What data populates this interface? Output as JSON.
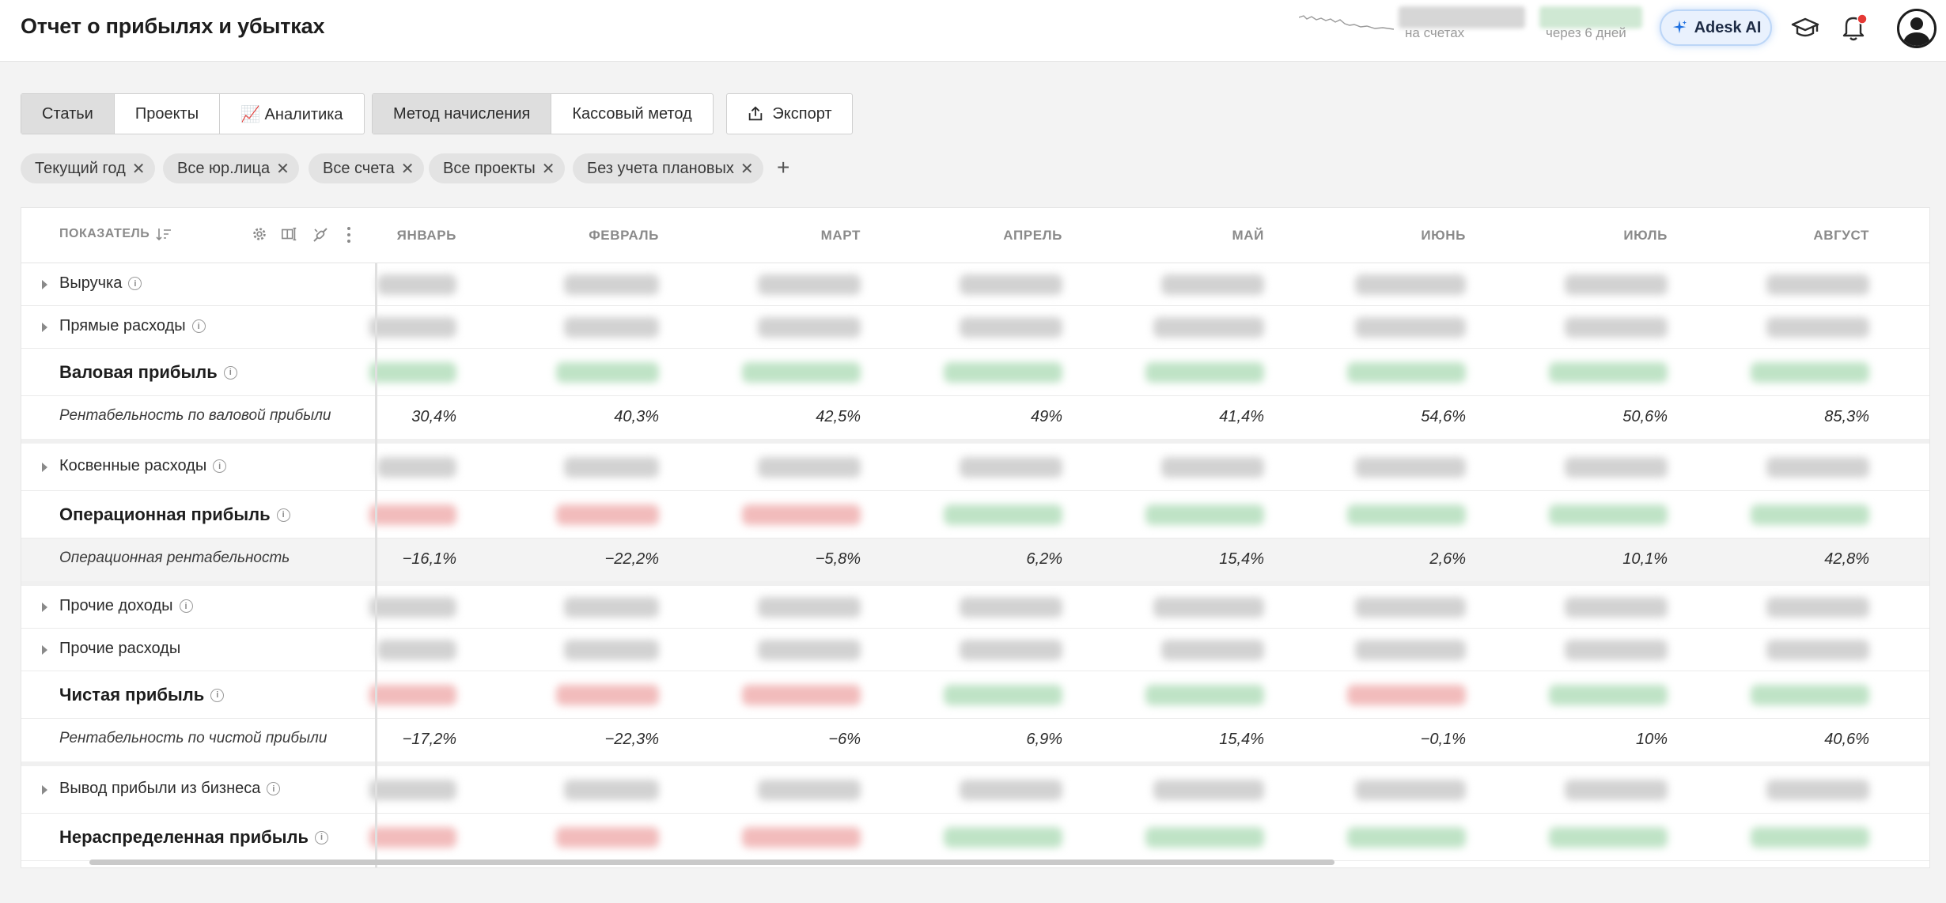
{
  "header": {
    "title": "Отчет о прибылях и убытках",
    "accounts_caption": "на счетах",
    "days_caption": "через 6 дней",
    "ai_label": "Adesk AI"
  },
  "toolbar": {
    "view_tabs": [
      "Статьи",
      "Проекты",
      "📈 Аналитика"
    ],
    "method_tabs": [
      "Метод начисления",
      "Кассовый метод"
    ],
    "export_label": "Экспорт"
  },
  "filters": [
    "Текущий год",
    "Все юр.лица",
    "Все счета",
    "Все проекты",
    "Без учета плановых"
  ],
  "table": {
    "indicator_header": "ПОКАЗАТЕЛЬ",
    "months": [
      "ЯНВАРЬ",
      "ФЕВРАЛЬ",
      "МАРТ",
      "АПРЕЛЬ",
      "МАЙ",
      "ИЮНЬ",
      "ИЮЛЬ",
      "АВГУСТ"
    ],
    "rows": [
      {
        "label": "Выручка",
        "style": "normal",
        "expand": true,
        "info": true,
        "values": null
      },
      {
        "label": "Прямые расходы",
        "style": "normal",
        "expand": true,
        "info": true,
        "values": null
      },
      {
        "label": "Валовая прибыль",
        "style": "bold",
        "expand": false,
        "info": true,
        "values": null
      },
      {
        "label": "Рентабельность по валовой прибыли",
        "style": "ital",
        "expand": false,
        "info": false,
        "values": [
          "30,4%",
          "40,3%",
          "42,5%",
          "49%",
          "41,4%",
          "54,6%",
          "50,6%",
          "85,3%"
        ]
      },
      {
        "label": "Косвенные расходы",
        "style": "normal",
        "expand": true,
        "info": true,
        "values": null
      },
      {
        "label": "Операционная прибыль",
        "style": "bold",
        "expand": false,
        "info": true,
        "values": null
      },
      {
        "label": "Операционная рентабельность",
        "style": "ital",
        "expand": false,
        "info": false,
        "values": [
          "−16,1%",
          "−22,2%",
          "−5,8%",
          "6,2%",
          "15,4%",
          "2,6%",
          "10,1%",
          "42,8%"
        ]
      },
      {
        "label": "Прочие доходы",
        "style": "normal",
        "expand": true,
        "info": true,
        "values": null
      },
      {
        "label": "Прочие расходы",
        "style": "normal",
        "expand": true,
        "info": false,
        "values": null
      },
      {
        "label": "Чистая прибыль",
        "style": "bold",
        "expand": false,
        "info": true,
        "values": null
      },
      {
        "label": "Рентабельность по чистой прибыли",
        "style": "ital",
        "expand": false,
        "info": false,
        "values": [
          "−17,2%",
          "−22,3%",
          "−6%",
          "6,9%",
          "15,4%",
          "−0,1%",
          "10%",
          "40,6%"
        ]
      },
      {
        "label": "Вывод прибыли из бизнеса",
        "style": "normal",
        "expand": true,
        "info": true,
        "values": null
      },
      {
        "label": "Нераспределенная прибыль",
        "style": "bold",
        "expand": false,
        "info": true,
        "values": null
      }
    ]
  },
  "colors": {
    "accent": "#1d6fe0",
    "blur_gray": "#d2d2d2",
    "blur_green": "#bfe3c6",
    "blur_red": "#f2bcbc",
    "notification_dot": "#e53935"
  },
  "icons": [
    "sort-icon",
    "gear-icon",
    "columns-icon",
    "unlink-icon",
    "more-vert-icon",
    "export-icon",
    "sparkle-icon",
    "graduation-cap-icon",
    "bell-icon",
    "user-avatar-icon",
    "plus-icon",
    "close-icon",
    "info-icon",
    "caret-right-icon"
  ]
}
